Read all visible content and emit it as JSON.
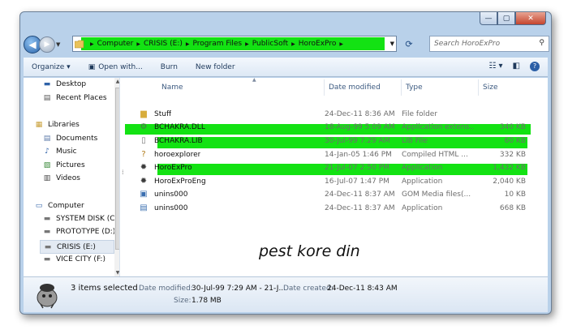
{
  "window": {
    "caption_buttons": [
      "—",
      "▢",
      "✕"
    ]
  },
  "address_bar": {
    "crumbs": [
      "Computer",
      "CRISIS (E:)",
      "Program Files",
      "PublicSoft",
      "HoroExPro"
    ],
    "separator": "▶",
    "highlight_color": "#13e213"
  },
  "search": {
    "placeholder": "Search HoroExPro",
    "icon": "search-icon"
  },
  "toolbar": {
    "organize": "Organize ▾",
    "open_with": "Open with...",
    "burn": "Burn",
    "new_folder": "New folder",
    "view_icon": "view-options-icon",
    "preview_icon": "preview-pane-icon",
    "help_icon": "help-icon"
  },
  "nav_pane": {
    "favorites": [
      {
        "label": "Desktop",
        "icon": "desktop-icon"
      },
      {
        "label": "Recent Places",
        "icon": "recent-places-icon"
      }
    ],
    "libraries_label": "Libraries",
    "libraries": [
      {
        "label": "Documents",
        "icon": "documents-icon"
      },
      {
        "label": "Music",
        "icon": "music-icon"
      },
      {
        "label": "Pictures",
        "icon": "pictures-icon"
      },
      {
        "label": "Videos",
        "icon": "videos-icon"
      }
    ],
    "computer_label": "Computer",
    "drives": [
      {
        "label": "SYSTEM DISK (C:)",
        "icon": "drive-icon"
      },
      {
        "label": "PROTOTYPE  (D:)",
        "icon": "drive-icon"
      },
      {
        "label": "CRISIS  (E:)",
        "icon": "drive-icon",
        "selected": true
      },
      {
        "label": "VICE CITY  (F:)",
        "icon": "drive-icon"
      }
    ]
  },
  "columns": [
    "Name",
    "Date modified",
    "Type",
    "Size"
  ],
  "files": [
    {
      "name": "Stuff",
      "date": "24-Dec-11 8:36 AM",
      "type": "File folder",
      "size": "",
      "icon": "folder-icon",
      "highlighted": false
    },
    {
      "name": "BCHAKRA.DLL",
      "date": "18-Aug-99 5:09 AM",
      "type": "Application extens...",
      "size": "340 KB",
      "icon": "dll-icon",
      "highlighted": true
    },
    {
      "name": "BCHAKRA.LIB",
      "date": "30-Jul-99 7:29 AM",
      "type": "LIB File",
      "size": "60 KB",
      "icon": "lib-file-icon",
      "highlighted": true
    },
    {
      "name": "horoexplorer",
      "date": "14-Jan-05 1:46 PM",
      "type": "Compiled HTML ...",
      "size": "332 KB",
      "icon": "help-file-icon",
      "highlighted": false
    },
    {
      "name": "HoroExPro",
      "date": "21-Jul-07 2:50 PM",
      "type": "Application",
      "size": "1,432 KB",
      "icon": "app-icon",
      "highlighted": true
    },
    {
      "name": "HoroExProEng",
      "date": "16-Jul-07 1:47 PM",
      "type": "Application",
      "size": "2,040 KB",
      "icon": "app-icon",
      "highlighted": false
    },
    {
      "name": "unins000",
      "date": "24-Dec-11 8:37 AM",
      "type": "GOM Media files(...",
      "size": "10 KB",
      "icon": "media-file-icon",
      "highlighted": false
    },
    {
      "name": "unins000",
      "date": "24-Dec-11 8:37 AM",
      "type": "Application",
      "size": "668 KB",
      "icon": "installer-icon",
      "highlighted": false
    }
  ],
  "annotation": "pest kore din",
  "details": {
    "selected_count": "3 items selected",
    "date_modified_label": "Date modified:",
    "date_modified_value": "30-Jul-99 7:29 AM - 21-J...",
    "date_created_label": "Date created:",
    "date_created_value": "24-Dec-11 8:43 AM",
    "size_label": "Size:",
    "size_value": "1.78 MB"
  }
}
